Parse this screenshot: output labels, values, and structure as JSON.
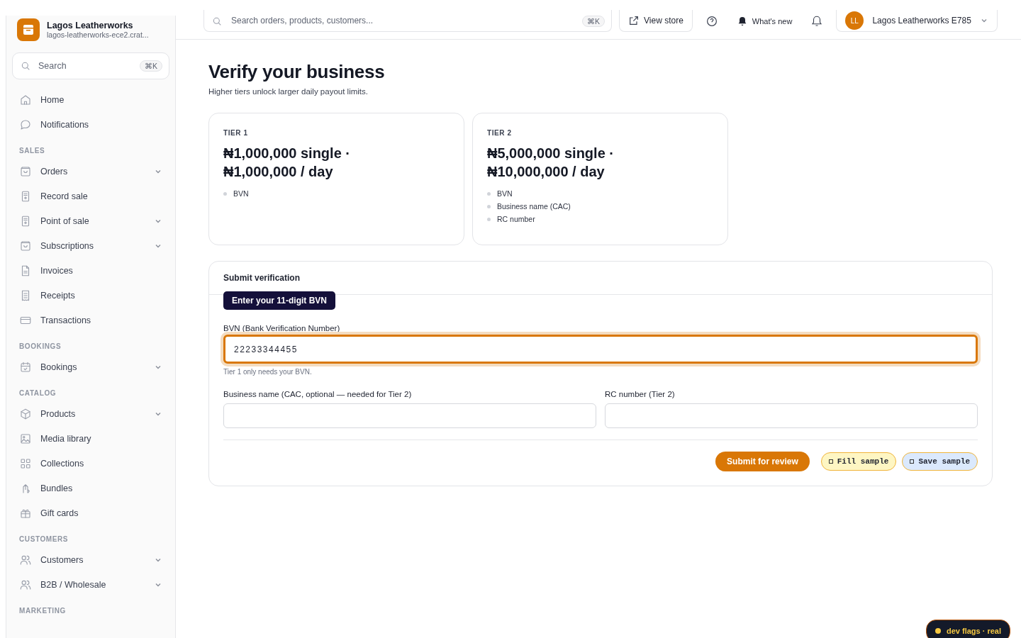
{
  "brand": {
    "name": "Lagos Leatherworks",
    "domain": "lagos-leatherworks-ece2.crat..."
  },
  "sidebar": {
    "search": {
      "placeholder": "Search",
      "shortcut": "⌘K"
    },
    "sections": [
      {
        "items": [
          {
            "label": "Home",
            "expandable": false
          },
          {
            "label": "Notifications",
            "expandable": false
          }
        ]
      },
      {
        "title": "SALES",
        "items": [
          {
            "label": "Orders",
            "expandable": true
          },
          {
            "label": "Record sale",
            "expandable": false
          },
          {
            "label": "Point of sale",
            "expandable": true
          },
          {
            "label": "Subscriptions",
            "expandable": true
          },
          {
            "label": "Invoices",
            "expandable": false
          },
          {
            "label": "Receipts",
            "expandable": false
          },
          {
            "label": "Transactions",
            "expandable": false
          }
        ]
      },
      {
        "title": "BOOKINGS",
        "items": [
          {
            "label": "Bookings",
            "expandable": true
          }
        ]
      },
      {
        "title": "CATALOG",
        "items": [
          {
            "label": "Products",
            "expandable": true
          },
          {
            "label": "Media library",
            "expandable": false
          },
          {
            "label": "Collections",
            "expandable": false
          },
          {
            "label": "Bundles",
            "expandable": false
          },
          {
            "label": "Gift cards",
            "expandable": false
          }
        ]
      },
      {
        "title": "CUSTOMERS",
        "items": [
          {
            "label": "Customers",
            "expandable": true
          },
          {
            "label": "B2B / Wholesale",
            "expandable": true
          }
        ]
      },
      {
        "title": "MARKETING"
      }
    ]
  },
  "topbar": {
    "search": {
      "placeholder": "Search orders, products, customers...",
      "shortcut": "⌘K"
    },
    "view_store": "View store",
    "whats_new": "What's new",
    "account": {
      "initials": "LL",
      "name": "Lagos Leatherworks E785"
    }
  },
  "page": {
    "title": "Verify your business",
    "subtitle": "Higher tiers unlock larger daily payout limits."
  },
  "tiers": [
    {
      "label": "TIER 1",
      "limit": "₦1,000,000 single · ₦1,000,000 / day",
      "requirements": [
        "BVN"
      ]
    },
    {
      "label": "TIER 2",
      "limit": "₦5,000,000 single · ₦10,000,000 / day",
      "requirements": [
        "BVN",
        "Business name (CAC)",
        "RC number"
      ]
    }
  ],
  "form": {
    "title": "Submit verification",
    "tooltip": "Enter your 11-digit BVN",
    "bvn": {
      "label": "BVN (Bank Verification Number)",
      "value": "22233344455",
      "hint": "Tier 1 only needs your BVN.",
      "focused": true
    },
    "fields": [
      {
        "label": "Business name (CAC, optional — needed for Tier 2)"
      },
      {
        "label": "RC number (Tier 2)"
      }
    ],
    "submit": "Submit for review",
    "dev_buttons": [
      {
        "label": "Fill sample",
        "color": "#fef6c3"
      },
      {
        "label": "Save sample",
        "color": "#dbe9fd"
      }
    ]
  },
  "dev_flags": "dev flags · real"
}
